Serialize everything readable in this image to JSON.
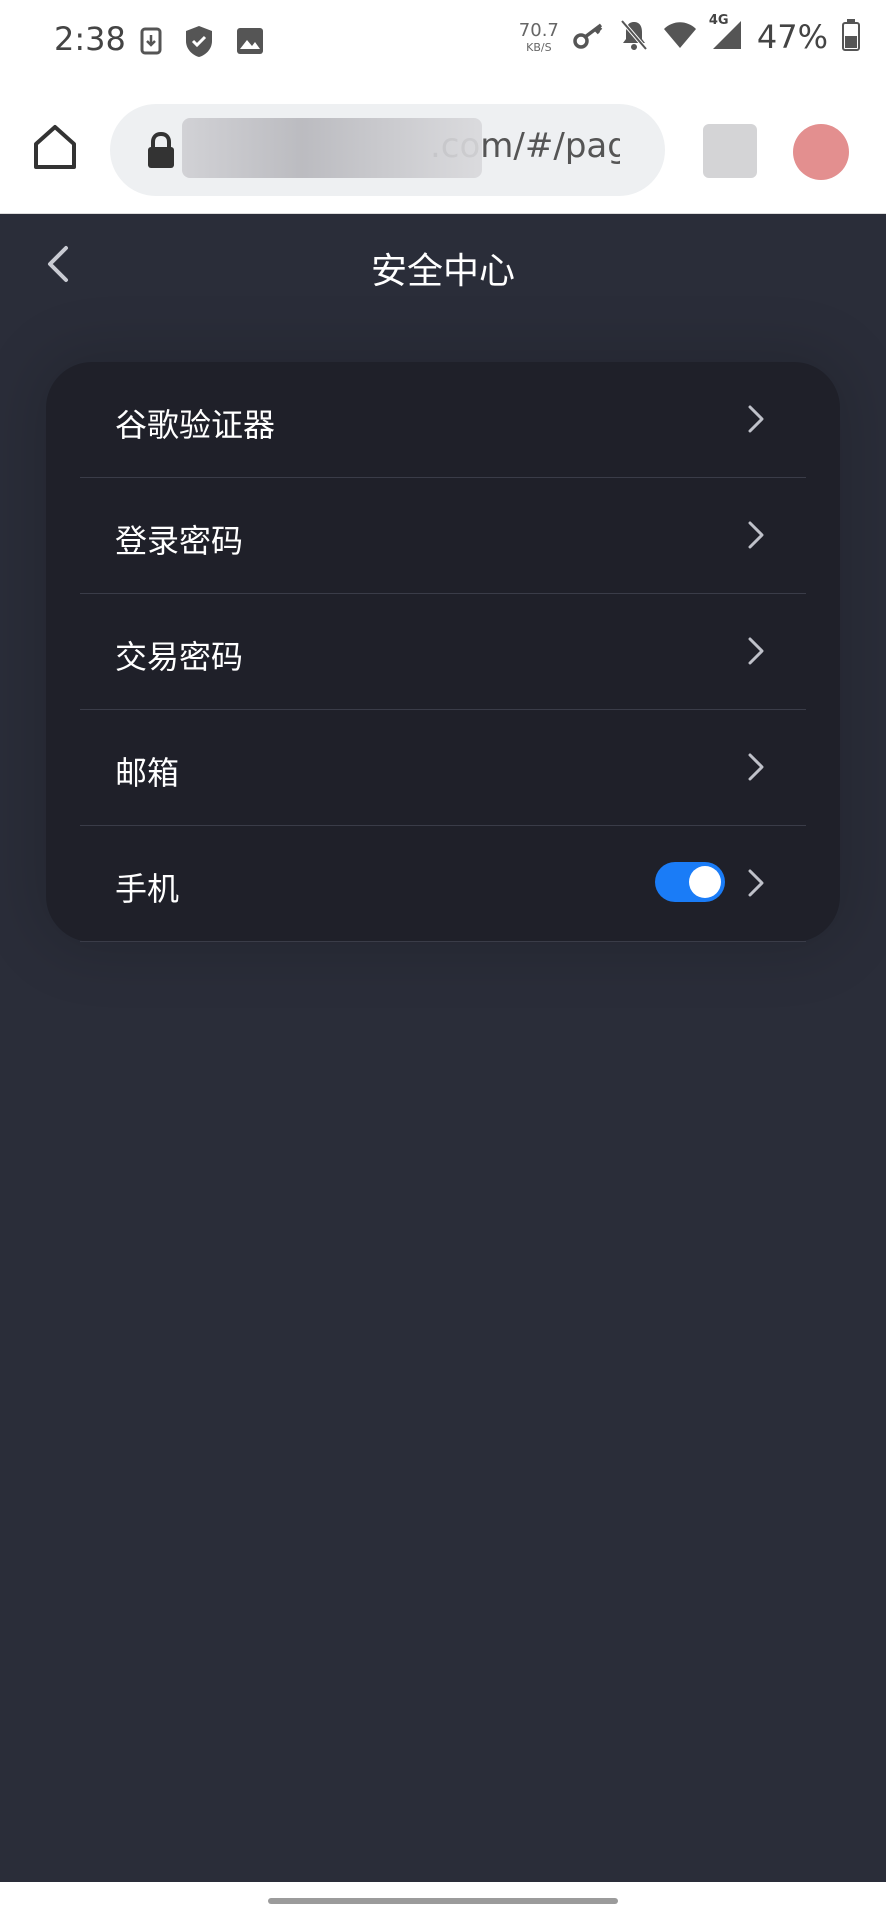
{
  "status_bar": {
    "time": "2:38",
    "net_speed_value": "70.7",
    "net_speed_unit": "KB/S",
    "network_type": "4G",
    "battery": "47%",
    "icons": [
      "download-icon",
      "shield-icon",
      "image-icon",
      "key-icon",
      "bell-off-icon",
      "wifi-icon",
      "signal-icon",
      "battery-icon"
    ]
  },
  "browser": {
    "url_visible": ".com/#/page"
  },
  "header": {
    "title": "安全中心"
  },
  "security_menu": {
    "items": [
      {
        "label": "谷歌验证器"
      },
      {
        "label": "登录密码"
      },
      {
        "label": "交易密码"
      },
      {
        "label": "邮箱"
      },
      {
        "label": "手机",
        "toggle_on": true
      }
    ]
  },
  "colors": {
    "background": "#2a2d39",
    "card": "#1f2029",
    "accent": "#1a7cf7"
  }
}
